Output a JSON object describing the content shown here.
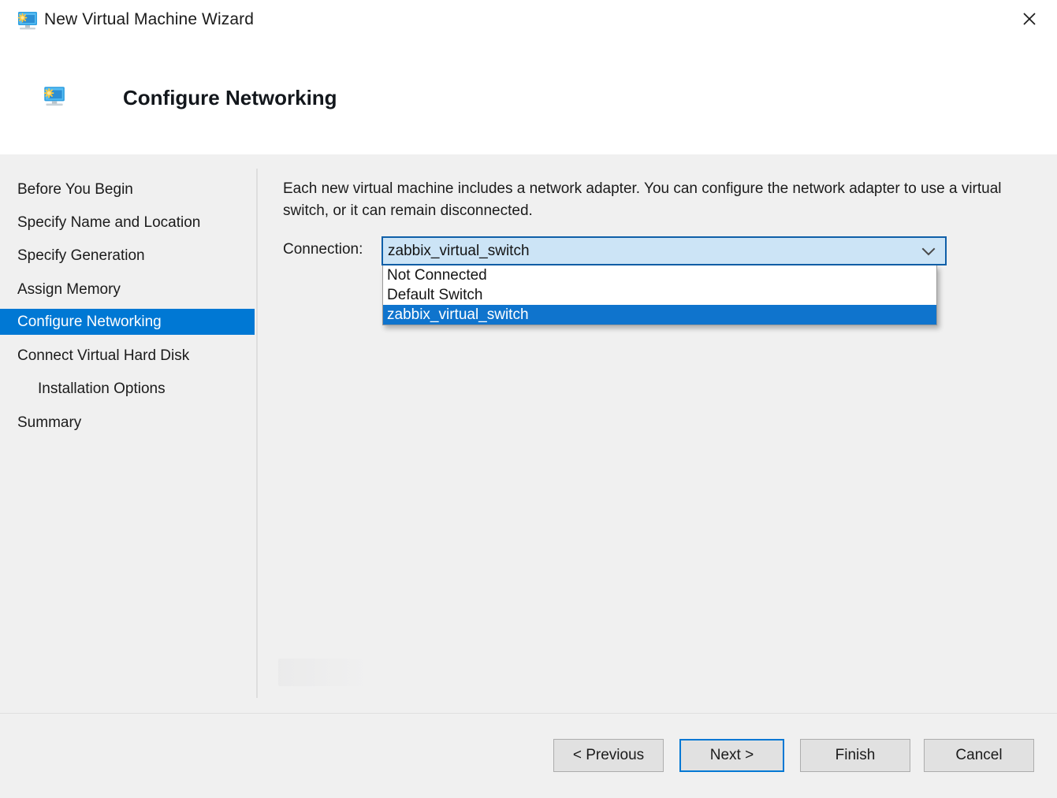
{
  "window": {
    "title": "New Virtual Machine Wizard",
    "title_icon": "virtual-machine-monitor-icon",
    "close_label": "✕"
  },
  "header": {
    "page_title": "Configure Networking",
    "page_icon": "virtual-machine-monitor-icon"
  },
  "sidebar": {
    "items": [
      {
        "label": "Before You Begin",
        "selected": false,
        "indent": false
      },
      {
        "label": "Specify Name and Location",
        "selected": false,
        "indent": false
      },
      {
        "label": "Specify Generation",
        "selected": false,
        "indent": false
      },
      {
        "label": "Assign Memory",
        "selected": false,
        "indent": false
      },
      {
        "label": "Configure Networking",
        "selected": true,
        "indent": false
      },
      {
        "label": "Connect Virtual Hard Disk",
        "selected": false,
        "indent": false
      },
      {
        "label": "Installation Options",
        "selected": false,
        "indent": true
      },
      {
        "label": "Summary",
        "selected": false,
        "indent": false
      }
    ]
  },
  "main": {
    "description": "Each new virtual machine includes a network adapter. You can configure the network adapter to use a virtual switch, or it can remain disconnected.",
    "connection_label": "Connection:",
    "connection_value": "zabbix_virtual_switch",
    "dropdown_arrow_icon": "chevron-down-icon",
    "dropdown_open": true,
    "dropdown_options": [
      {
        "label": "Not Connected",
        "selected": false
      },
      {
        "label": "Default Switch",
        "selected": false
      },
      {
        "label": "zabbix_virtual_switch",
        "selected": true
      }
    ]
  },
  "footer": {
    "previous_label": "< Previous",
    "next_label": "Next >",
    "finish_label": "Finish",
    "cancel_label": "Cancel"
  },
  "colors": {
    "accent": "#0078d4",
    "selection_blue": "#0f74cd",
    "combo_fill": "#cce4f6",
    "combo_border": "#0f5fa8",
    "body_bg": "#f0f0f0",
    "titlebar_bg": "#ffffff"
  }
}
